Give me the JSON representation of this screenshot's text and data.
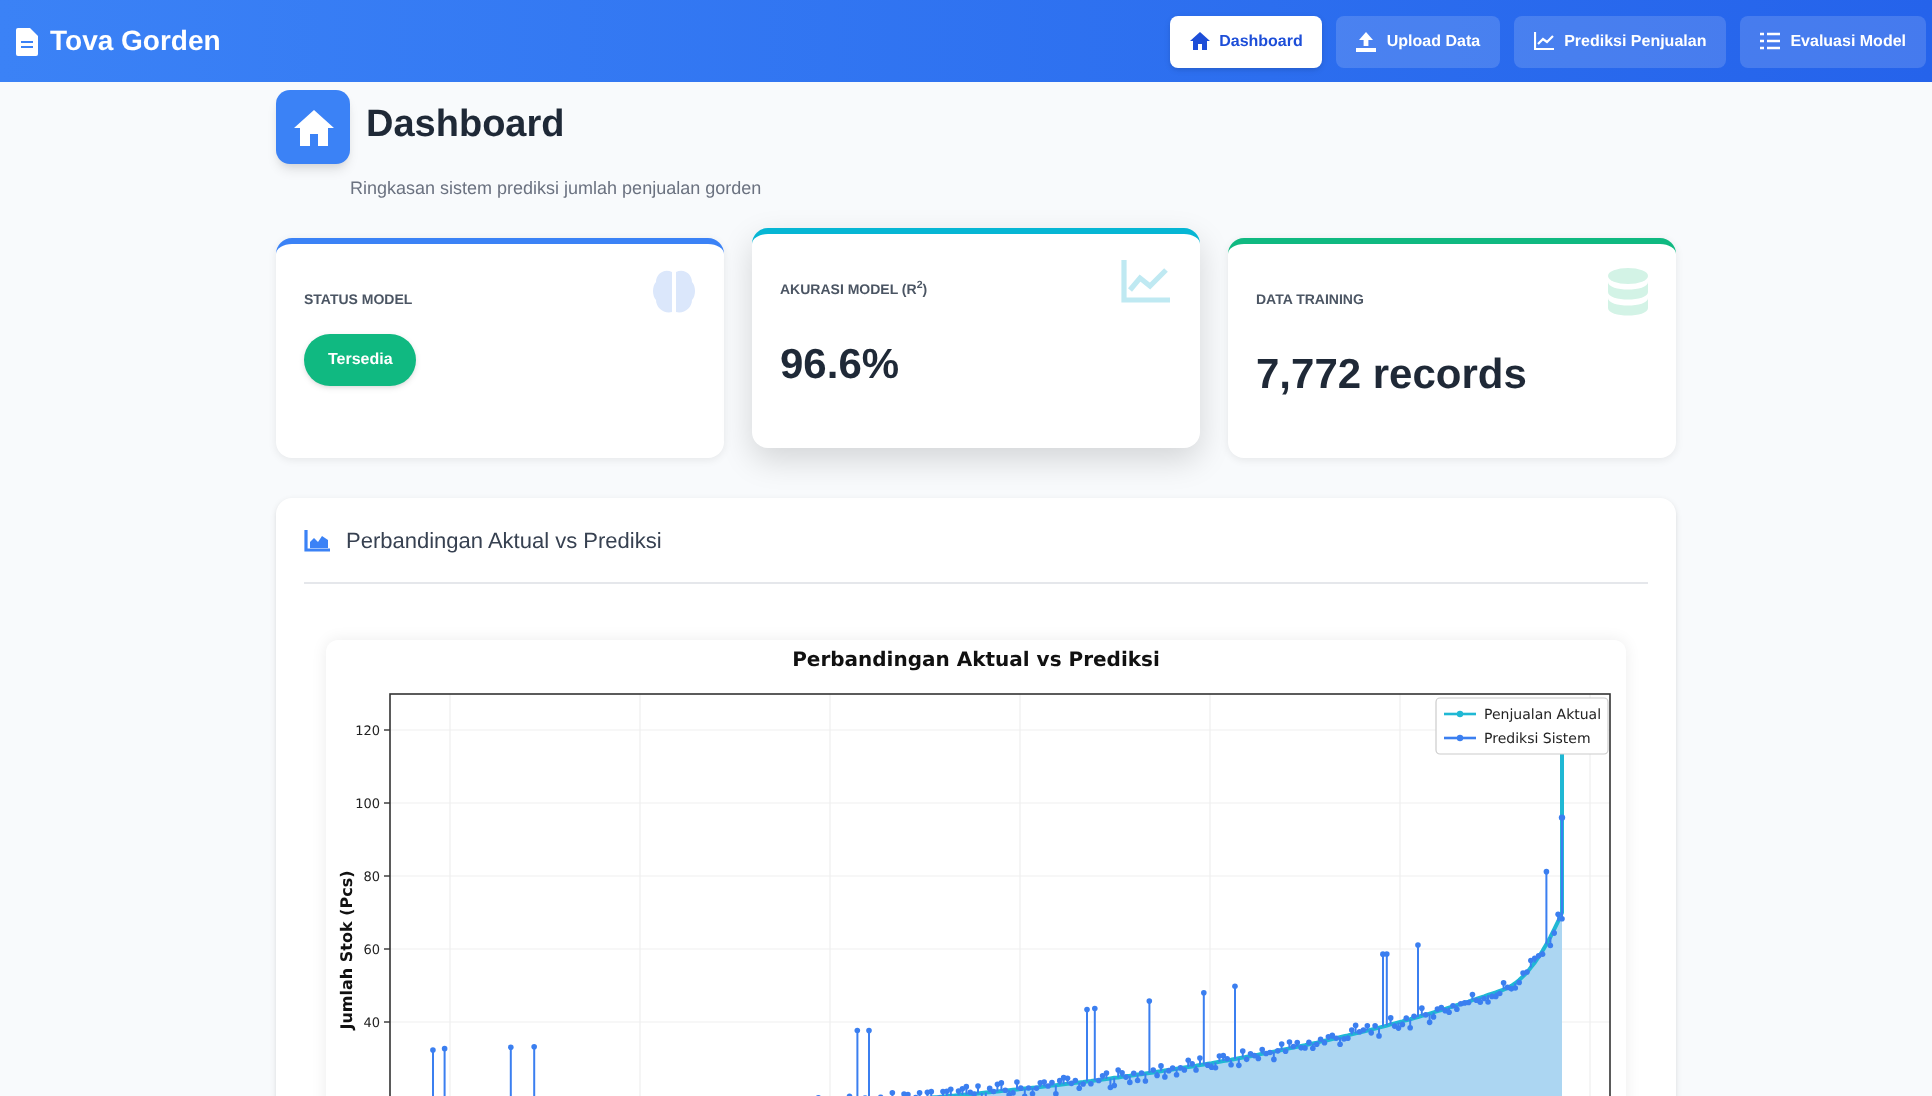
{
  "navbar": {
    "brand": "Tova Gorden",
    "links": [
      {
        "label": "Dashboard",
        "selected": true
      },
      {
        "label": "Upload Data",
        "selected": false
      },
      {
        "label": "Prediksi Penjualan",
        "selected": false
      },
      {
        "label": "Evaluasi Model",
        "selected": false
      }
    ]
  },
  "page_header": {
    "title": "Dashboard",
    "subtitle": "Ringkasan sistem prediksi jumlah penjualan gorden"
  },
  "stats": [
    {
      "kind": "badge",
      "label": "STATUS MODEL",
      "value": "Tersedia",
      "color": "#3b82f6",
      "highlighted": false
    },
    {
      "kind": "value",
      "label": "AKURASI MODEL (R$^{2}$)",
      "value": "96.6%",
      "color": "#06b6d4",
      "highlighted": true
    },
    {
      "kind": "value",
      "label": "DATA TRAINING",
      "value": "7,772 records",
      "color": "#10b981",
      "highlighted": false
    }
  ],
  "chart_section": {
    "title": "Perbandingan Aktual vs Prediksi",
    "plot": {
      "title": "Perbandingan Aktual vs Prediksi",
      "ylabel": "Jumlah Stok (Pcs)",
      "yticks": [
        "120",
        "100",
        "80",
        "60",
        "40"
      ],
      "legend": [
        {
          "label": "Penjualan Aktual",
          "color": "#1fb8d4"
        },
        {
          "label": "Prediksi Sistem",
          "color": "#3b7ff0"
        }
      ]
    }
  }
}
